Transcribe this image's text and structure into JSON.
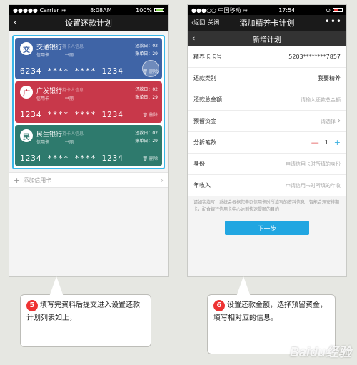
{
  "left_screen": {
    "status": {
      "carrier": "●●●●● Carrier",
      "time": "8:08AM",
      "battery": "100%"
    },
    "nav": {
      "back_icon": "‹",
      "title": "设置还款计划"
    },
    "cards": [
      {
        "bank": "交通银行",
        "blur_text": "持卡人信息",
        "type": "信用卡",
        "holder": "**丽",
        "payment_day": "还款日：02",
        "bill_day": "账单日：29",
        "number": "6234 **** **** 1234",
        "delete": "删除",
        "color": "#3f64a6",
        "logo": "交"
      },
      {
        "bank": "广发银行",
        "blur_text": "持卡人信息",
        "type": "信用卡",
        "holder": "**丽",
        "payment_day": "还款日：02",
        "bill_day": "账单日：29",
        "number": "1234 **** **** 1234",
        "delete": "删除",
        "color": "#c8384a",
        "logo": "广"
      },
      {
        "bank": "民生银行",
        "blur_text": "持卡人信息",
        "type": "信用卡",
        "holder": "**丽",
        "payment_day": "还款日：02",
        "bill_day": "账单日：29",
        "number": "1234 **** **** 1234",
        "delete": "删除",
        "color": "#2e7a6d",
        "logo": "民"
      }
    ],
    "add_card": "添加信用卡"
  },
  "right_screen": {
    "status": {
      "carrier": "●●●○○ 中国移动",
      "time": "17:54",
      "battery": ""
    },
    "nav": {
      "back": "返回",
      "close": "关闭",
      "title": "添加精养卡计划",
      "more": "•••"
    },
    "subnav_title": "新增计划",
    "form": {
      "card_no_label": "精养卡卡号",
      "card_no_value": "5203********7857",
      "repay_type_label": "还款类别",
      "repay_type_value": "我要精养",
      "total_label": "还款总金额",
      "total_placeholder": "请输入还款总金额",
      "reserve_label": "预留资金",
      "reserve_placeholder": "请选择",
      "split_label": "分拆笔数",
      "split_value": "1",
      "identity_label": "身份",
      "identity_placeholder": "申请信用卡时所填的身份",
      "income_label": "年收入",
      "income_placeholder": "申请信用卡时所填的年收"
    },
    "notice": "请如实填写，系统会根据您申办信用卡时所填写的资料信息，智能合理安排期卡，配合银行信用卡中心达到快速提额的目的",
    "next_button": "下一步"
  },
  "captions": {
    "left_num": "5",
    "left_text": "填写完资料后提交进入设置还款计划列表如上，",
    "right_num": "6",
    "right_text": "设置还款金额，选择预留资金，填写相对应的信息。"
  },
  "watermark": "Baidu经验"
}
